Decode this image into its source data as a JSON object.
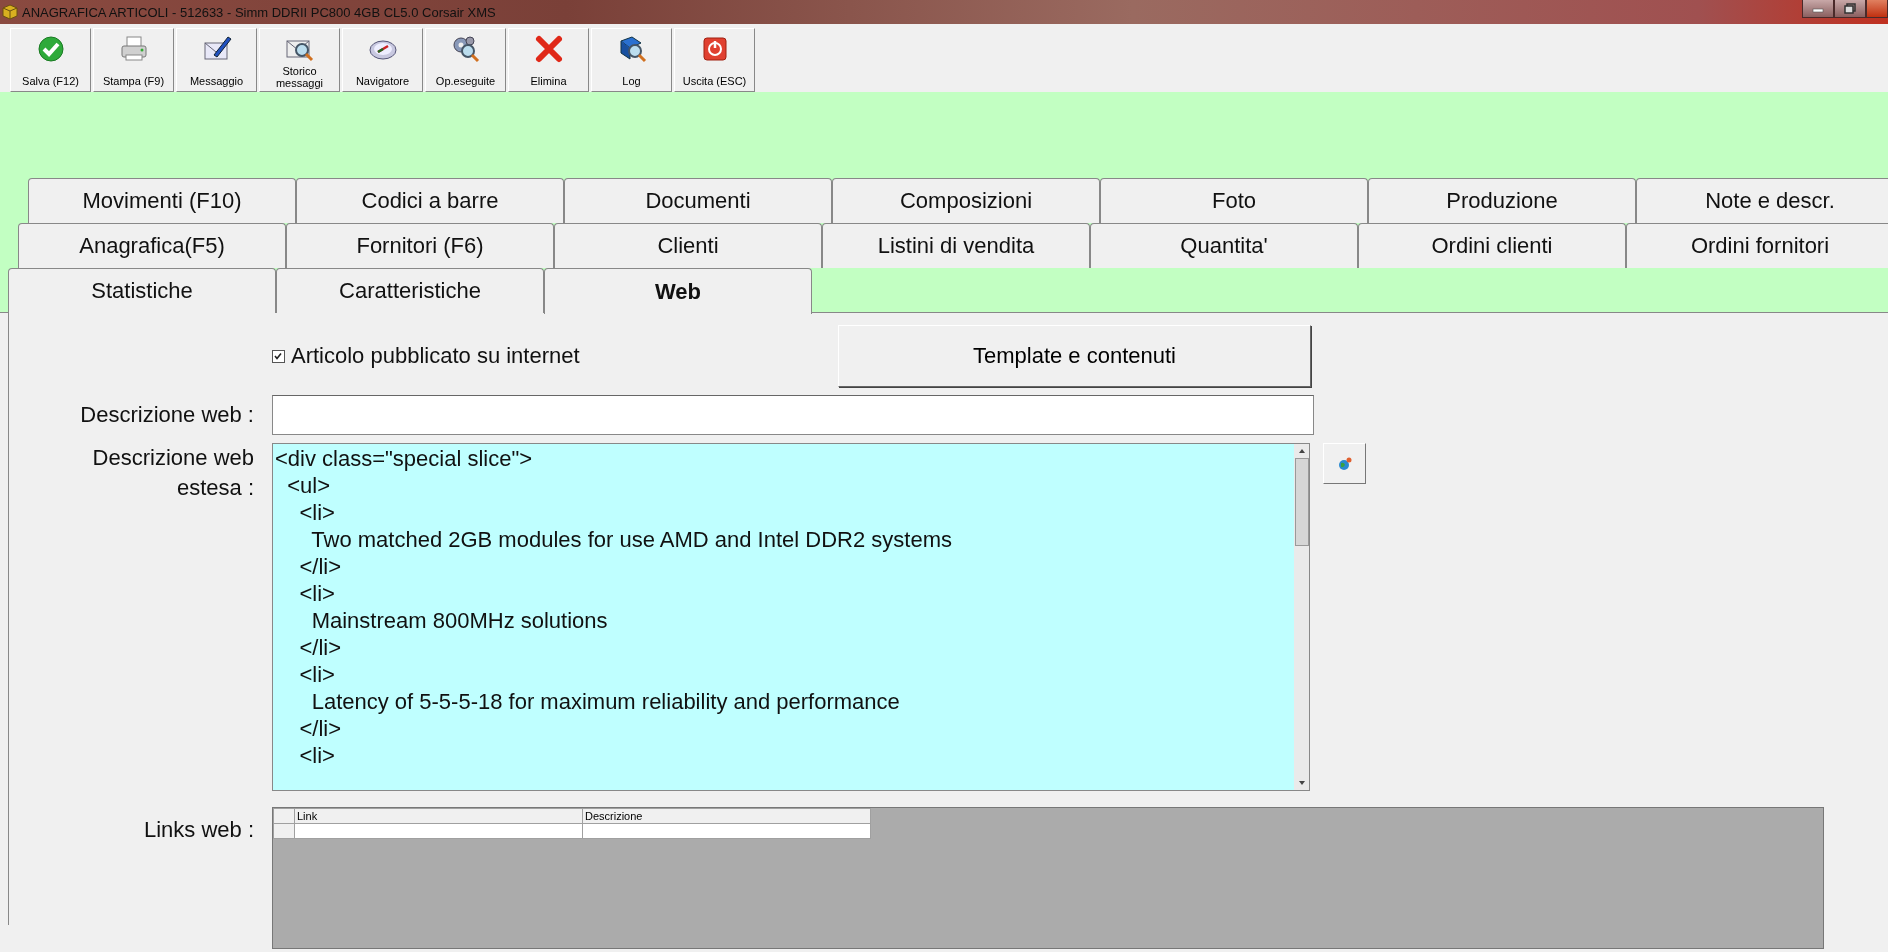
{
  "window": {
    "title": "ANAGRAFICA ARTICOLI - 512633 - Simm DDRII PC800 4GB CL5.0 Corsair XMS"
  },
  "toolbar": [
    {
      "label": "Salva (F12)"
    },
    {
      "label": "Stampa (F9)"
    },
    {
      "label": "Messaggio"
    },
    {
      "label": "Storico messaggi"
    },
    {
      "label": "Navigatore"
    },
    {
      "label": "Op.eseguite"
    },
    {
      "label": "Elimina"
    },
    {
      "label": "Log"
    },
    {
      "label": "Uscita (ESC)"
    }
  ],
  "tab_rows": [
    [
      {
        "label": "Movimenti (F10)",
        "selected": false
      },
      {
        "label": "Codici a barre",
        "selected": false
      },
      {
        "label": "Documenti",
        "selected": false
      },
      {
        "label": "Composizioni",
        "selected": false
      },
      {
        "label": "Foto",
        "selected": false
      },
      {
        "label": "Produzione",
        "selected": false
      },
      {
        "label": "Note e descr.",
        "selected": false
      }
    ],
    [
      {
        "label": "Anagrafica(F5)",
        "selected": false
      },
      {
        "label": "Fornitori (F6)",
        "selected": false
      },
      {
        "label": "Clienti",
        "selected": false
      },
      {
        "label": "Listini di vendita",
        "selected": false
      },
      {
        "label": "Quantita'",
        "selected": false
      },
      {
        "label": "Ordini clienti",
        "selected": false
      },
      {
        "label": "Ordini fornitori",
        "selected": false
      }
    ],
    [
      {
        "label": "Statistiche",
        "selected": false
      },
      {
        "label": "Caratteristiche",
        "selected": false
      },
      {
        "label": "Web",
        "selected": true
      }
    ]
  ],
  "web": {
    "published": {
      "label": "Articolo pubblicato su internet",
      "checked": true
    },
    "template_button": "Template e contenuti",
    "description_label": "Descrizione web :",
    "extended_label": "Descrizione web estesa :",
    "extended_text": "<div class=\"special slice\">\n  <ul>\n    <li>\n      Two matched 2GB modules for use AMD and Intel DDR2 systems\n    </li>\n    <li>\n      Mainstream 800MHz solutions\n    </li>\n    <li>\n      Latency of 5-5-5-18 for maximum reliability and performance\n    </li>\n    <li>",
    "links_label": "Links web :",
    "links_columns": [
      "Link",
      "Descrizione"
    ]
  }
}
